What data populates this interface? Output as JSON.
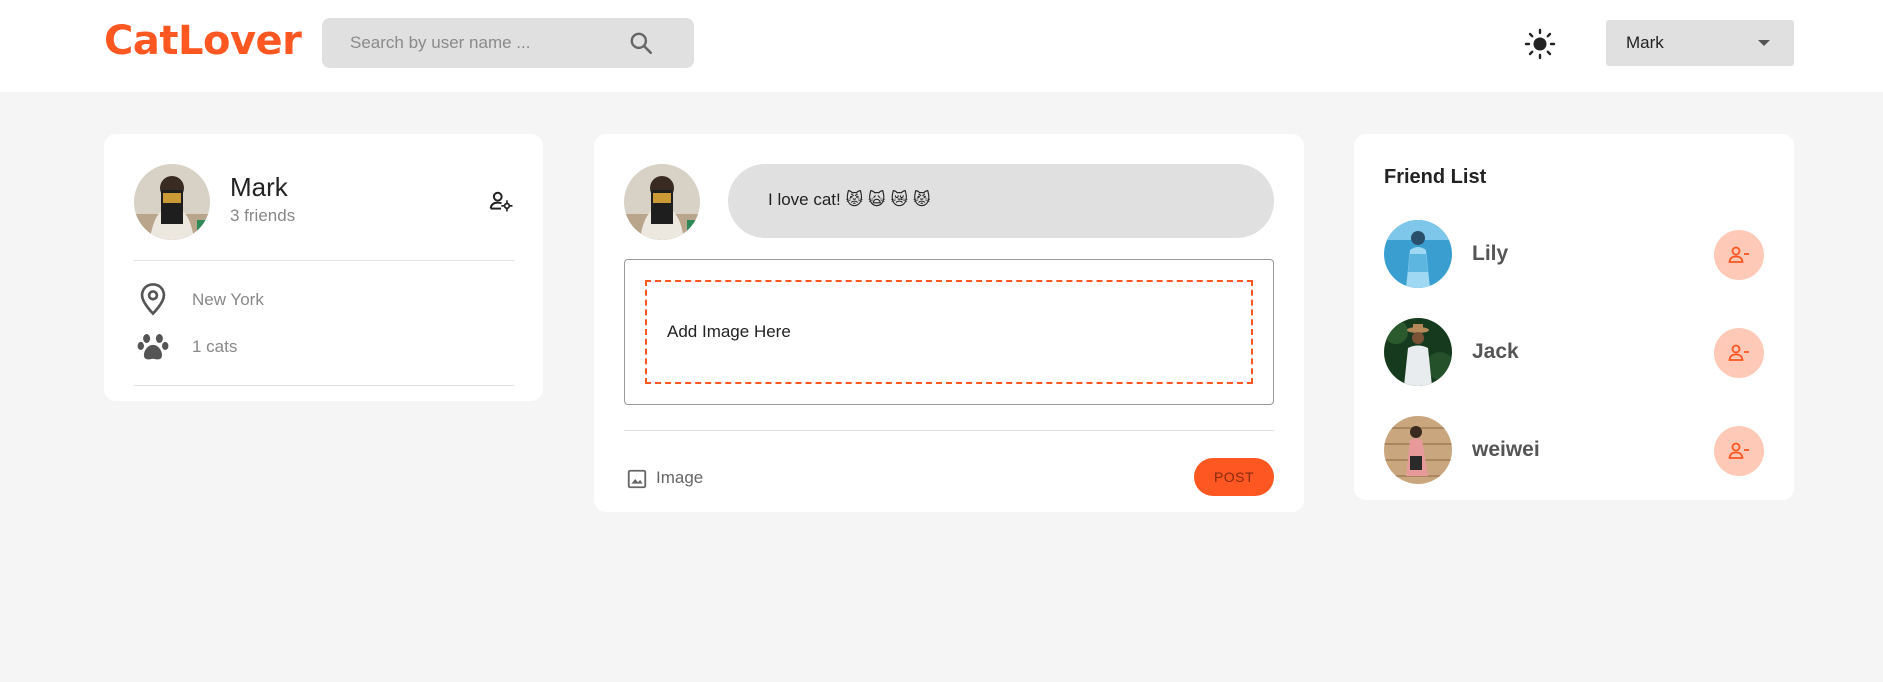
{
  "header": {
    "logo": "CatLover",
    "search_placeholder": "Search by user name ...",
    "user_select_value": "Mark"
  },
  "profile": {
    "name": "Mark",
    "friends": "3 friends",
    "location": "New York",
    "cats": "1 cats"
  },
  "composer": {
    "input_text": "I love cat! 😾 🙀 😿 😾",
    "dropzone_label": "Add Image Here",
    "image_label": "Image",
    "post_label": "POST"
  },
  "friend_list": {
    "title": "Friend List",
    "items": [
      {
        "name": "Lily"
      },
      {
        "name": "Jack"
      },
      {
        "name": "weiwei"
      }
    ]
  },
  "colors": {
    "accent": "#ff5722",
    "accent_light": "#ffc9b8",
    "page_bg": "#f5f5f5"
  },
  "icons": [
    "search-icon",
    "sun-icon",
    "caret-down-icon",
    "manage-accounts-icon",
    "location-pin-icon",
    "paw-icon",
    "image-icon",
    "person-remove-icon"
  ]
}
